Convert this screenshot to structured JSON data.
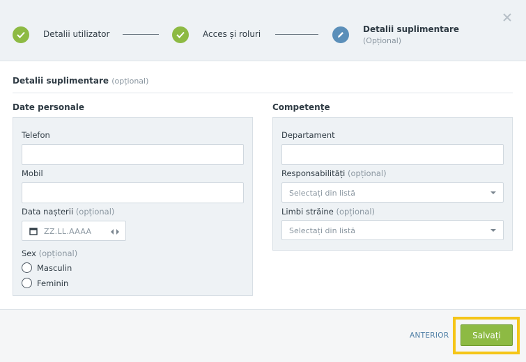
{
  "stepper": {
    "steps": [
      {
        "label": "Detalii utilizator",
        "state": "done",
        "icon": "checkmark-icon"
      },
      {
        "label": "Acces și roluri",
        "state": "done",
        "icon": "checkmark-icon"
      },
      {
        "label": "Detalii suplimentare",
        "sublabel": "(Opțional)",
        "state": "active",
        "icon": "pencil-icon"
      }
    ],
    "close_icon": "close-icon"
  },
  "section": {
    "title": "Detalii suplimentare",
    "optional": "(opțional)"
  },
  "personal": {
    "title": "Date personale",
    "phone_label": "Telefon",
    "phone_value": "",
    "mobile_label": "Mobil",
    "mobile_value": "",
    "birth_label": "Data nașterii",
    "birth_optional": "(opțional)",
    "birth_placeholder": "ZZ.LL.AAAA",
    "sex_label": "Sex",
    "sex_optional": "(opțional)",
    "sex_options": [
      "Masculin",
      "Feminin"
    ]
  },
  "skills": {
    "title": "Competențe",
    "department_label": "Departament",
    "department_value": "",
    "resp_label": "Responsabilități",
    "resp_optional": "(opțional)",
    "resp_placeholder": "Selectați din listă",
    "lang_label": "Limbi străine",
    "lang_optional": "(opțional)",
    "lang_placeholder": "Selectați din listă"
  },
  "footer": {
    "prev_label": "ANTERIOR",
    "save_label": "Salvați"
  },
  "colors": {
    "accent_green": "#8dba43",
    "accent_blue": "#5b8fb9",
    "highlight": "#f5c518",
    "link": "#4f7fa6"
  }
}
